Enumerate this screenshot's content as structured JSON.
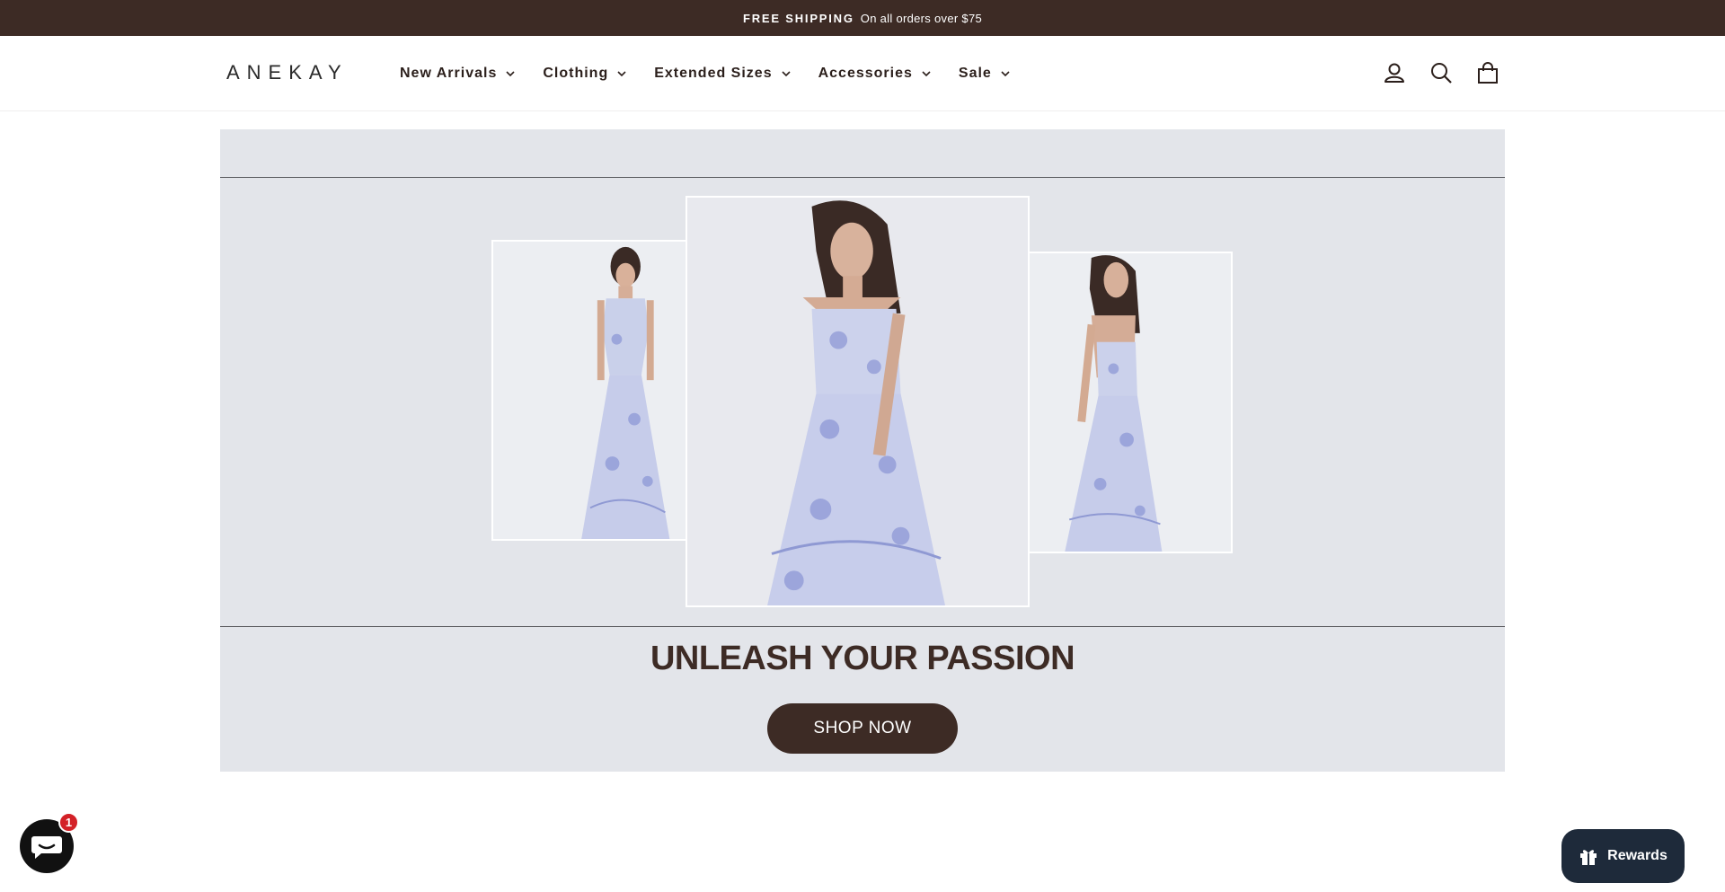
{
  "announcement": {
    "strong": "FREE SHIPPING",
    "rest": "On all orders over $75"
  },
  "header": {
    "logo": "ANEKAY",
    "nav": [
      {
        "label": "New Arrivals"
      },
      {
        "label": "Clothing"
      },
      {
        "label": "Extended Sizes"
      },
      {
        "label": "Accessories"
      },
      {
        "label": "Sale"
      }
    ],
    "icons": [
      "account-icon",
      "search-icon",
      "cart-icon"
    ]
  },
  "hero": {
    "title": "UNLEASH YOUR PASSION",
    "button": "SHOP NOW",
    "background": "#e3e5ea"
  },
  "chat": {
    "icon": "chat-icon",
    "badge_count": "1"
  },
  "rewards": {
    "label": "Rewards",
    "icon": "gift-icon"
  },
  "colors": {
    "brand_dark": "#3d2b25",
    "rewards_bg": "#1e2a3a",
    "badge": "#d32127"
  }
}
